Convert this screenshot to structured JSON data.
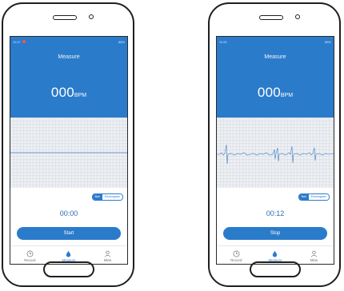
{
  "screens": [
    {
      "status_left": "11:47",
      "status_right": "88%",
      "title": "Measure",
      "bpm_value": "000",
      "bpm_unit": "BPM",
      "toggle": [
        "Ball",
        "Electrogram"
      ],
      "toggle_active": 0,
      "timer": "00:00",
      "action_label": "Start",
      "waveform": "flat",
      "tabs": [
        {
          "label": "Record",
          "icon": "clock-icon",
          "active": false
        },
        {
          "label": "Measure",
          "icon": "drop-icon",
          "active": true
        },
        {
          "label": "Mine",
          "icon": "person-icon",
          "active": false
        }
      ]
    },
    {
      "status_left": "11:52",
      "status_right": "88%",
      "title": "Measure",
      "bpm_value": "000",
      "bpm_unit": "BPM",
      "toggle": [
        "Ball",
        "Electrogram"
      ],
      "toggle_active": 0,
      "timer": "00:12",
      "action_label": "Stop",
      "waveform": "ecg",
      "tabs": [
        {
          "label": "Record",
          "icon": "clock-icon",
          "active": false
        },
        {
          "label": "Measure",
          "icon": "drop-icon",
          "active": true
        },
        {
          "label": "Mine",
          "icon": "person-icon",
          "active": false
        }
      ]
    }
  ],
  "colors": {
    "primary": "#2b7bcb",
    "grid_bg": "#eef0f3",
    "wave_line": "#3d7fc9"
  }
}
